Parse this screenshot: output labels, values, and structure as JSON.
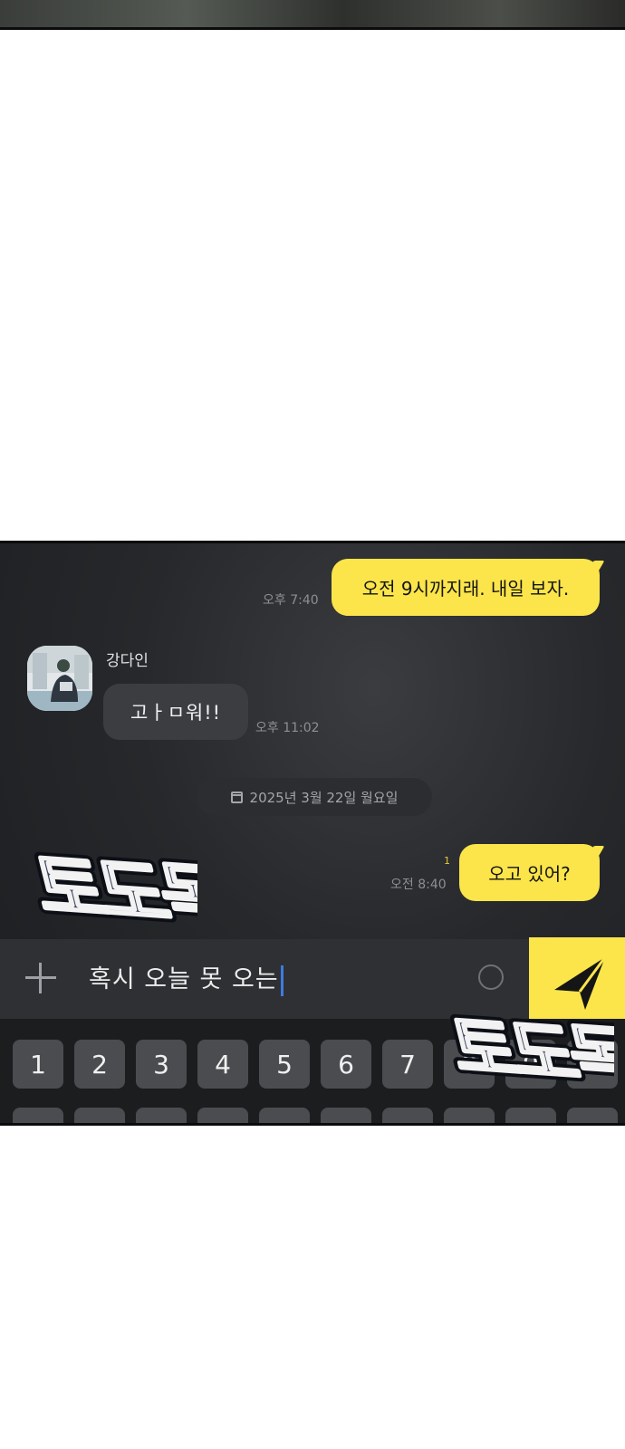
{
  "messages": {
    "out1": {
      "text": "오전 9시까지래. 내일 보자.",
      "time": "오후 7:40"
    },
    "in1": {
      "sender": "강다인",
      "text": "고ㅏㅁ워!!",
      "time": "오후 11:02"
    },
    "date_divider": "2025년 3월 22일 월요일",
    "out2": {
      "text": "오고 있어?",
      "time": "오전 8:40",
      "unread": "1"
    }
  },
  "input": {
    "text": "혹시 오늘 못 오는"
  },
  "keyboard": {
    "number_row": [
      "1",
      "2",
      "3",
      "4",
      "5",
      "6",
      "7",
      "8",
      "9"
    ]
  },
  "sfx": {
    "text": "토도독"
  },
  "colors": {
    "accent": "#fbe54a",
    "panel_bg": "#26282b",
    "caret": "#3d7be0"
  }
}
